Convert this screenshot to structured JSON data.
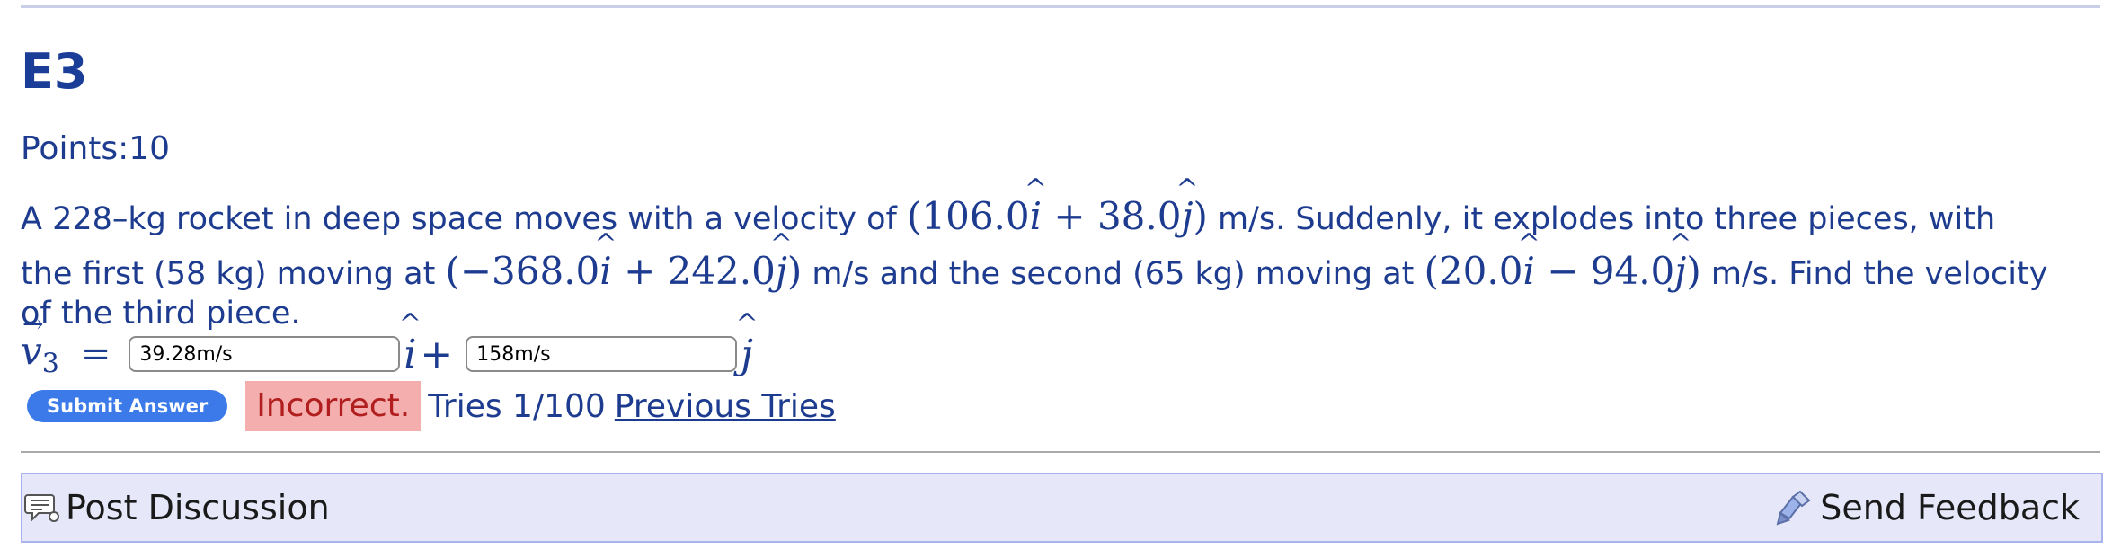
{
  "problem": {
    "title": "E3",
    "points_label": "Points:10",
    "line1_text": "A 228–kg rocket in deep space moves with a velocity of",
    "line1_math_num1": "(106.0",
    "line1_math_plus": " + 38.0",
    "line1_math_close": ")",
    "line1_tail": "m/s. Suddenly, it explodes into three pieces, with",
    "line2_text": "the first (58 kg) moving at",
    "line2_math_num1": "(−368.0",
    "line2_math_plus": " + 242.0",
    "line2_math_close": ")",
    "line2_mid": "m/s and the second (65 kg) moving at",
    "line2_math2_num1": "(20.0",
    "line2_math2_minus": " − 94.0",
    "line2_math2_close": ")",
    "line2_tail": "m/s. Find the velocity",
    "line3_text": "of the third piece."
  },
  "answer": {
    "vector_symbol": "v",
    "vector_subscript": "3",
    "equals": "=",
    "i_value": "39.28m/s",
    "j_value": "158m/s",
    "i_hat": "i",
    "j_hat": "j",
    "plus": "+"
  },
  "status": {
    "submit_label": "Submit Answer",
    "result": "Incorrect.",
    "tries": "Tries 1/100",
    "previous_tries": "Previous Tries"
  },
  "footer": {
    "post_discussion": "Post Discussion",
    "send_feedback": "Send Feedback"
  },
  "colors": {
    "text": "#1d3b8f",
    "submit": "#3b7ae8",
    "incorrect_bg": "#f4aeae",
    "footer_bg": "#e6e8fa"
  }
}
